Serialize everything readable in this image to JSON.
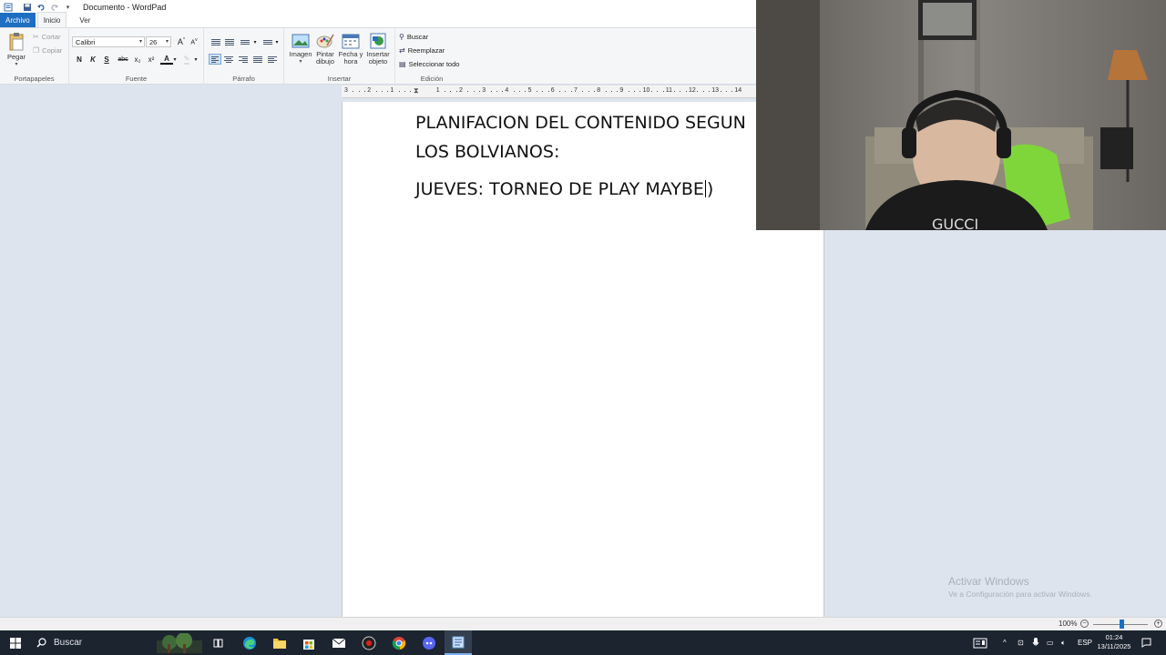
{
  "window": {
    "title": "Documento - WordPad"
  },
  "ribbon": {
    "tabs": [
      "Archivo",
      "Inicio",
      "Ver"
    ],
    "clipboard": {
      "paste_label": "Pegar",
      "cut_label": "Cortar",
      "copy_label": "Copiar",
      "group_label": "Portapapeles"
    },
    "font": {
      "family": "Calibri",
      "size": "26",
      "bold": "N",
      "italic": "K",
      "underline": "S",
      "strike": "abc",
      "subscript": "x₂",
      "superscript": "x²",
      "color_letter": "A",
      "group_label": "Fuente"
    },
    "paragraph": {
      "group_label": "Párrafo"
    },
    "insert": {
      "image_label": "Imagen",
      "paint_label": "Pintar dibujo",
      "datetime_label": "Fecha y hora",
      "object_label": "Insertar objeto",
      "group_label": "Insertar"
    },
    "editing": {
      "find_label": "Buscar",
      "replace_label": "Reemplazar",
      "select_all_label": "Seleccionar todo",
      "group_label": "Edición"
    }
  },
  "ruler": {
    "numbers": [
      "3",
      "2",
      "1",
      "1",
      "2",
      "3",
      "4",
      "5",
      "6",
      "7",
      "8",
      "9",
      "10",
      "11",
      "12",
      "13",
      "14"
    ]
  },
  "document": {
    "line1": "PLANIFACION DEL CONTENIDO SEGUN",
    "line2": "LOS BOLVIANOS:",
    "line3_before_caret": "JUEVES: TORNEO DE PLAY MAYBE",
    "line3_after_caret": ")"
  },
  "watermark": {
    "title": "Activar Windows",
    "subtitle": "Ve a Configuración para activar Windows."
  },
  "statusbar": {
    "zoom": "100%",
    "zoom_level_percent": 100
  },
  "taskbar": {
    "search_placeholder": "Buscar",
    "language": "ESP",
    "time": "01:24",
    "date": "13/11/2025"
  },
  "colors": {
    "accent": "#1e6fc1",
    "taskbar": "#1c2430",
    "workspace": "#dde4ee"
  }
}
